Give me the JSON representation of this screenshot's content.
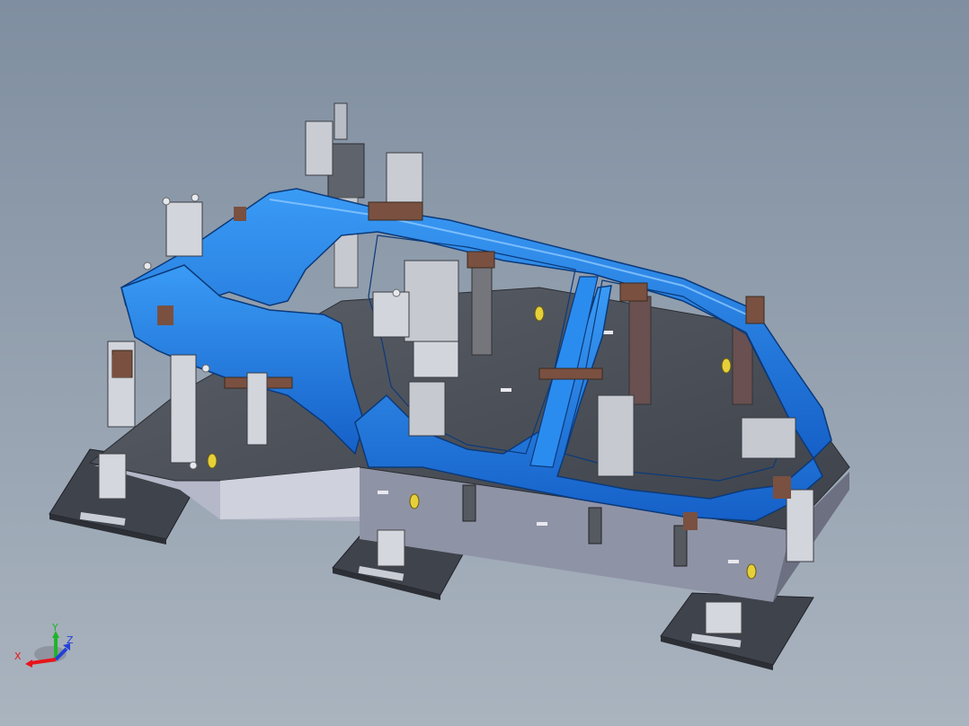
{
  "triad": {
    "x_label": "X",
    "y_label": "Y",
    "z_label": "Z",
    "x_color": "#e8141a",
    "y_color": "#1fb52b",
    "z_color": "#2340d8"
  },
  "colors": {
    "background_top": "#7f8ea0",
    "background_bottom": "#aab4bf",
    "body_panel": "#1f78e0",
    "base_plate": "#4a4e57",
    "clamp_metal": "#c8ccd2",
    "locator_brown": "#7a5040",
    "label_yellow": "#e6d03a"
  }
}
